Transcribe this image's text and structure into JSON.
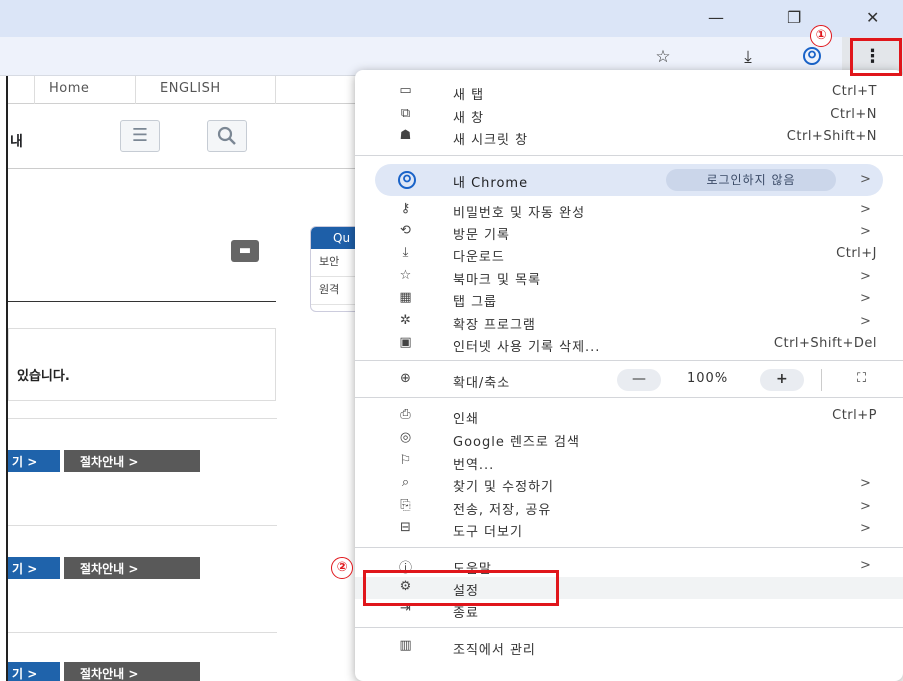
{
  "browser": {
    "window_controls": {
      "minimize": "—",
      "restore": "❐",
      "close": "✕"
    },
    "toolbar_icons": [
      "star-icon",
      "download-icon",
      "profile-icon",
      "more-icon"
    ]
  },
  "page": {
    "nav": [
      "Home",
      "ENGLISH"
    ],
    "title_fragment": "내",
    "quick_box": {
      "header": "Qu",
      "items": [
        "보안",
        "원격"
      ]
    },
    "notice_text": "있습니다.",
    "rows": [
      {
        "left_btn": "기 >",
        "right_btn": "절차안내 >"
      },
      {
        "left_btn": "기 >",
        "right_btn": "절차안내 >"
      },
      {
        "left_btn": "기 >",
        "right_btn": "절차안내 >"
      }
    ]
  },
  "menu": {
    "new_tab": {
      "label": "새 탭",
      "shortcut": "Ctrl+T"
    },
    "new_window": {
      "label": "새 창",
      "shortcut": "Ctrl+N"
    },
    "new_incognito": {
      "label": "새 시크릿 창",
      "shortcut": "Ctrl+Shift+N"
    },
    "profile": {
      "label": "내 Chrome",
      "status": "로그인하지 않음"
    },
    "passwords": {
      "label": "비밀번호 및 자동 완성"
    },
    "history": {
      "label": "방문 기록"
    },
    "downloads": {
      "label": "다운로드",
      "shortcut": "Ctrl+J"
    },
    "bookmarks": {
      "label": "북마크 및 목록"
    },
    "tab_groups": {
      "label": "탭 그룹"
    },
    "extensions": {
      "label": "확장 프로그램"
    },
    "clear_data": {
      "label": "인터넷 사용 기록 삭제...",
      "shortcut": "Ctrl+Shift+Del"
    },
    "zoom": {
      "label": "확대/축소",
      "minus": "—",
      "value": "100%",
      "plus": "+",
      "fullscreen": "⛶"
    },
    "print": {
      "label": "인쇄",
      "shortcut": "Ctrl+P"
    },
    "google_lens": {
      "label": "Google 렌즈로 검색"
    },
    "translate": {
      "label": "번역..."
    },
    "find_edit": {
      "label": "찾기 및 수정하기"
    },
    "cast_save_share": {
      "label": "전송, 저장, 공유"
    },
    "more_tools": {
      "label": "도구 더보기"
    },
    "help": {
      "label": "도움말"
    },
    "settings": {
      "label": "설정"
    },
    "exit": {
      "label": "종료"
    },
    "managed": {
      "label": "조직에서 관리"
    },
    "arrow": ">"
  },
  "annotations": {
    "step1": "①",
    "step2": "②",
    "accent": "#e0161b"
  }
}
